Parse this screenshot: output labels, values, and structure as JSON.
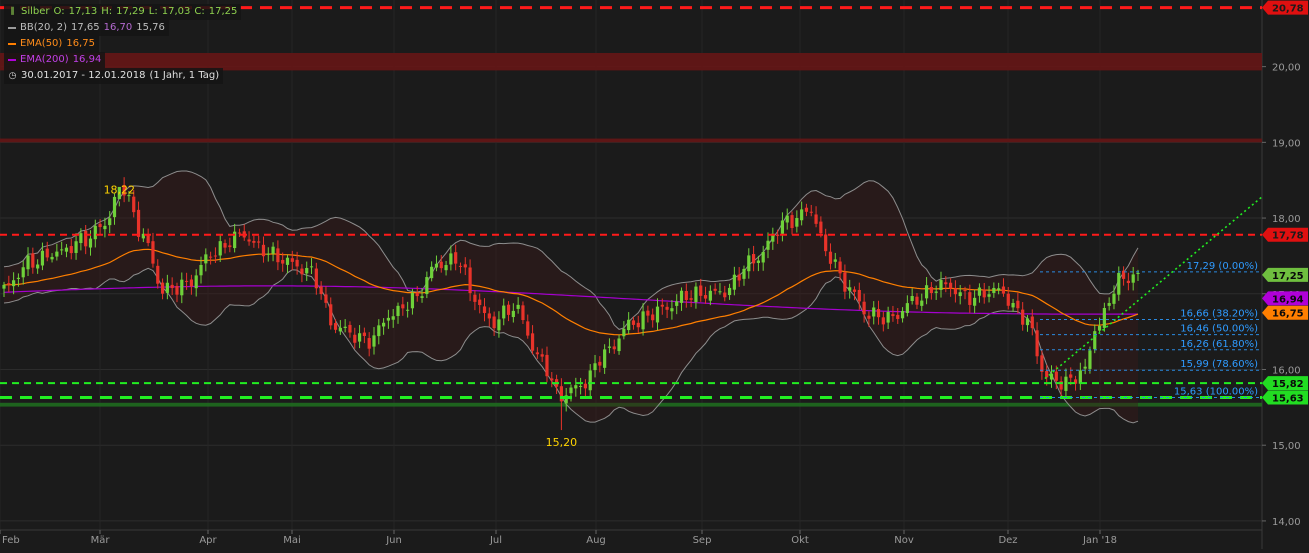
{
  "chart_data": {
    "type": "candlestick",
    "instrument": "Silber",
    "ohlc": {
      "O_label": "O:",
      "O": "17,13",
      "H_label": "H:",
      "H": "17,29",
      "L_label": "L:",
      "L": "17,03",
      "C_label": "C:",
      "C": "17,25"
    },
    "indicators": [
      {
        "label": "BB(20, 2)",
        "values": [
          "17,65",
          "16,70",
          "15,76"
        ],
        "color": "#9a9a9a"
      },
      {
        "label": "EMA(50)",
        "values": [
          "16,75"
        ],
        "color": "#ff7f00"
      },
      {
        "label": "EMA(200)",
        "values": [
          "16,94"
        ],
        "color": "#b000d8"
      }
    ],
    "period": {
      "range": "30.01.2017 - 12.01.2018",
      "info": "(1 Jahr, 1 Tag)"
    },
    "x_labels": [
      "Feb",
      "Mär",
      "Apr",
      "Mai",
      "Jun",
      "Jul",
      "Aug",
      "Sep",
      "Okt",
      "Nov",
      "Dez",
      "Jan '18"
    ],
    "y_ticks": [
      "20,00",
      "19,00",
      "18,00",
      "17,00",
      "16,00",
      "15,00",
      "14,00"
    ],
    "ylim": [
      13.88,
      20.88
    ],
    "annotations": {
      "high": "18,22",
      "low": "15,20"
    },
    "horizontal_lines": [
      {
        "value": 20.78,
        "label": "20,78",
        "style": "dashed",
        "color": "#ff1a1a"
      },
      {
        "value": 17.78,
        "label": "17,78",
        "style": "dashed",
        "color": "#ff1a1a"
      },
      {
        "value": 15.82,
        "label": "15,82",
        "style": "dashed",
        "color": "#22ee22"
      },
      {
        "value": 15.63,
        "label": "15,63",
        "style": "dashed",
        "color": "#22ee22"
      }
    ],
    "resistance_zones": [
      {
        "from": 19.95,
        "to": 20.18
      },
      {
        "from": 19.0,
        "to": 19.05
      }
    ],
    "support_zones": [
      {
        "from": 15.51,
        "to": 15.56
      }
    ],
    "price_tags": [
      {
        "value": 17.25,
        "label": "17,25",
        "color": "#6fbf3f"
      },
      {
        "value": 16.94,
        "label": "16,94",
        "color": "#b000d8"
      },
      {
        "value": 16.75,
        "label": "16,75",
        "color": "#ff7f00"
      }
    ],
    "fibonacci": [
      {
        "value": 17.29,
        "label": "17,29 (0.00%)"
      },
      {
        "value": 16.66,
        "label": "16,66 (38.20%)"
      },
      {
        "value": 16.46,
        "label": "16,46 (50.00%)"
      },
      {
        "value": 16.26,
        "label": "16,26 (61.80%)"
      },
      {
        "value": 15.99,
        "label": "15,99 (78.60%)"
      },
      {
        "value": 15.63,
        "label": "15,63 (100.00%)"
      }
    ]
  }
}
